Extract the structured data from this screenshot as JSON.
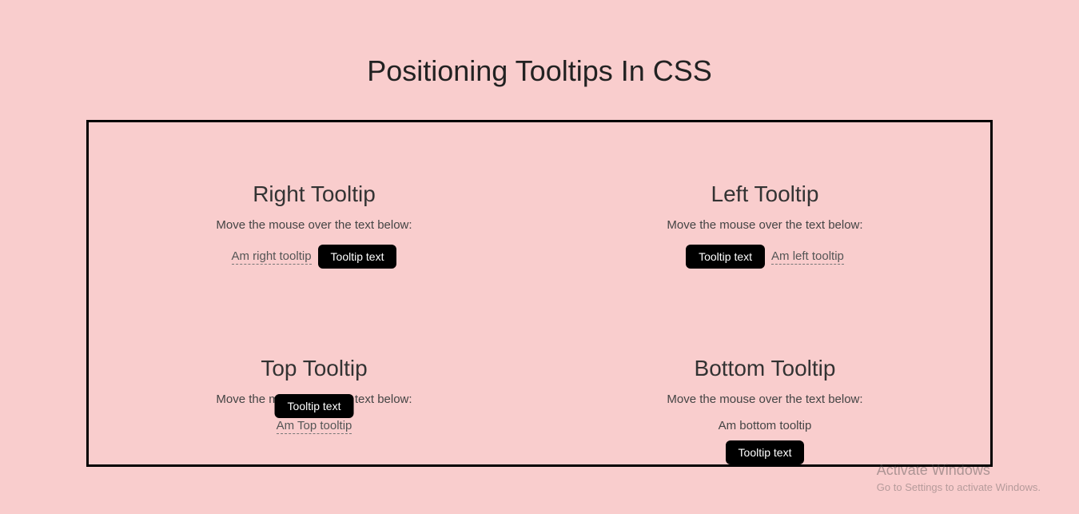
{
  "page_title": "Positioning Tooltips In CSS",
  "hint_text": "Move the mouse over the text below:",
  "tooltip_label": "Tooltip text",
  "tooltips": {
    "right": {
      "heading": "Right Tooltip",
      "trigger": "Am right tooltip"
    },
    "left": {
      "heading": "Left Tooltip",
      "trigger": "Am left tooltip"
    },
    "top": {
      "heading": "Top Tooltip",
      "trigger": "Am Top tooltip"
    },
    "bottom": {
      "heading": "Bottom Tooltip",
      "trigger": "Am bottom tooltip"
    }
  },
  "watermark": {
    "line1": "Activate Windows",
    "line2": "Go to Settings to activate Windows."
  },
  "colors": {
    "background": "#f9cdcd",
    "tooltip_bg": "#000000",
    "tooltip_fg": "#ffffff",
    "border": "#000000"
  }
}
